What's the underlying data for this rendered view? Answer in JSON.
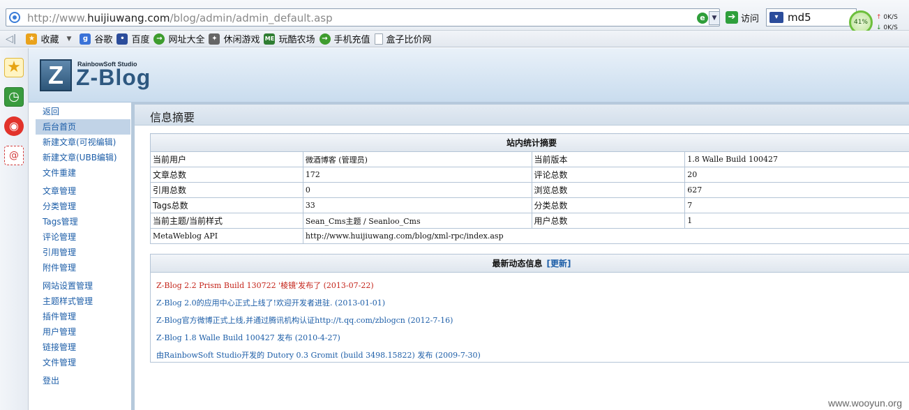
{
  "browser": {
    "url_prefix": "http://www.",
    "url_host": "huijiuwang.com",
    "url_path": "/blog/admin/admin_default.asp",
    "visit_label": "访问",
    "search_value": "md5",
    "speed_percent": "41%",
    "speed_up": "0K/S",
    "speed_down": "0K/S",
    "favorites": [
      {
        "label": "收藏",
        "icon": "star-icon",
        "color": "#e9a21c"
      },
      {
        "label": "谷歌",
        "icon": "google-icon",
        "color": "#3a72d8"
      },
      {
        "label": "百度",
        "icon": "baidu-paw-icon",
        "color": "#2b4c9b"
      },
      {
        "label": "网址大全",
        "icon": "green-globe-icon",
        "color": "#3e9c2e"
      },
      {
        "label": "休闲游戏",
        "icon": "gamepad-icon",
        "color": "#666666"
      },
      {
        "label": "玩酷农场",
        "icon": "farm-icon",
        "color": "#2f7d32"
      },
      {
        "label": "手机充值",
        "icon": "green-globe-icon",
        "color": "#3e9c2e"
      },
      {
        "label": "盒子比价网",
        "icon": "page-icon",
        "color": "#9aa6b2"
      }
    ]
  },
  "admin": {
    "logo_studio": "RainbowSoft Studio",
    "logo_name": "Z-Blog",
    "nav": [
      {
        "label": "返回"
      },
      {
        "label": "后台首页",
        "active": true
      },
      {
        "label": "新建文章(可视编辑)"
      },
      {
        "label": "新建文章(UBB编辑)"
      },
      {
        "label": "文件重建"
      },
      {
        "label": "文章管理",
        "gap": true
      },
      {
        "label": "分类管理"
      },
      {
        "label": "Tags管理"
      },
      {
        "label": "评论管理"
      },
      {
        "label": "引用管理"
      },
      {
        "label": "附件管理"
      },
      {
        "label": "网站设置管理",
        "gap": true
      },
      {
        "label": "主题样式管理"
      },
      {
        "label": "插件管理"
      },
      {
        "label": "用户管理"
      },
      {
        "label": "链接管理"
      },
      {
        "label": "文件管理"
      },
      {
        "label": "登出",
        "gap": true
      }
    ],
    "page_title": "信息摘要",
    "stats_title": "站内统计摘要",
    "stats_rows": [
      [
        "当前用户",
        "微酒博客 (管理员)",
        "当前版本",
        "1.8 Walle Build 100427"
      ],
      [
        "文章总数",
        "172",
        "评论总数",
        "20"
      ],
      [
        "引用总数",
        "0",
        "浏览总数",
        "627"
      ],
      [
        "Tags总数",
        "33",
        "分类总数",
        "7"
      ],
      [
        "当前主题/当前样式",
        "Sean_Cms主题 / Seanloo_Cms",
        "用户总数",
        "1"
      ]
    ],
    "api_label": "MetaWeblog API",
    "api_url": "http://www.huijiuwang.com/blog/xml-rpc/index.asp",
    "news_title": "最新动态信息",
    "news_refresh": "[更新]",
    "news": [
      {
        "text": "Z-Blog 2.2 Prism Build 130722 '棱镜'发布了 (2013-07-22)",
        "hot": true
      },
      {
        "text": "Z-Blog 2.0的应用中心正式上线了!欢迎开发者进驻. (2013-01-01)"
      },
      {
        "text": "Z-Blog官方微博正式上线,并通过腾讯机构认证http://t.qq.com/zblogcn (2012-7-16)"
      },
      {
        "text": "Z-Blog 1.8 Walle Build 100427 发布 (2010-4-27)"
      },
      {
        "text": "由RainbowSoft Studio开发的 Dutory 0.3 Gromit (build 3498.15822) 发布 (2009-7-30)"
      }
    ]
  },
  "watermark": "www.wooyun.org"
}
